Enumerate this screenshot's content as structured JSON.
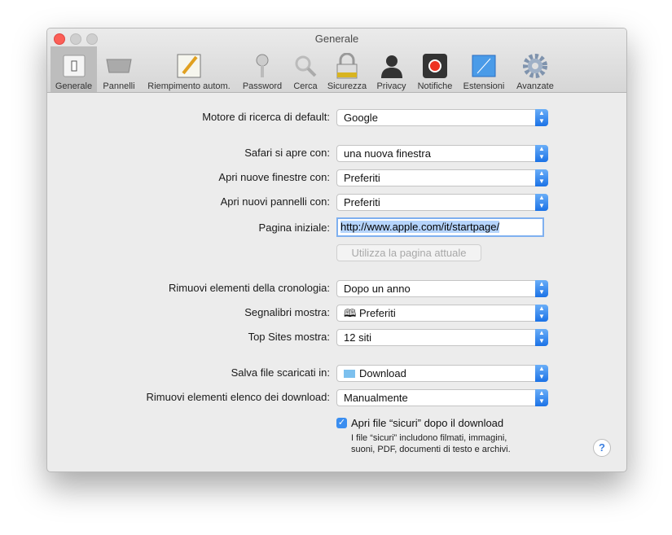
{
  "window": {
    "title": "Generale"
  },
  "toolbar": [
    {
      "label": "Generale",
      "icon": "switch-icon"
    },
    {
      "label": "Pannelli",
      "icon": "tabs-icon"
    },
    {
      "label": "Riempimento autom.",
      "icon": "pencil-form-icon"
    },
    {
      "label": "Password",
      "icon": "key-icon"
    },
    {
      "label": "Cerca",
      "icon": "magnifier-icon"
    },
    {
      "label": "Sicurezza",
      "icon": "padlock-icon"
    },
    {
      "label": "Privacy",
      "icon": "person-silhouette-icon"
    },
    {
      "label": "Notifiche",
      "icon": "notification-icon"
    },
    {
      "label": "Estensioni",
      "icon": "puzzle-icon"
    },
    {
      "label": "Avanzate",
      "icon": "gear-icon"
    }
  ],
  "settings": {
    "search_engine": {
      "label": "Motore di ricerca di default:",
      "value": "Google"
    },
    "opens_with": {
      "label": "Safari si apre con:",
      "value": "una nuova finestra"
    },
    "new_windows": {
      "label": "Apri nuove finestre con:",
      "value": "Preferiti"
    },
    "new_tabs": {
      "label": "Apri nuovi pannelli con:",
      "value": "Preferiti"
    },
    "homepage": {
      "label": "Pagina iniziale:",
      "value": "http://www.apple.com/it/startpage/"
    },
    "use_current": "Utilizza la pagina attuale",
    "history": {
      "label": "Rimuovi elementi della cronologia:",
      "value": "Dopo un anno"
    },
    "bookmarks": {
      "label": "Segnalibri mostra:",
      "value": "Preferiti"
    },
    "topsites": {
      "label": "Top Sites mostra:",
      "value": "12 siti"
    },
    "download_dir": {
      "label": "Salva file scaricati in:",
      "value": "Download"
    },
    "download_list": {
      "label": "Rimuovi elementi elenco dei download:",
      "value": "Manualmente"
    },
    "open_safe": {
      "label": "Apri file “sicuri” dopo il download",
      "checked": true
    },
    "note1": "I file “sicuri” includono filmati, immagini,",
    "note2": "suoni, PDF, documenti di testo e archivi.",
    "help": "?"
  }
}
